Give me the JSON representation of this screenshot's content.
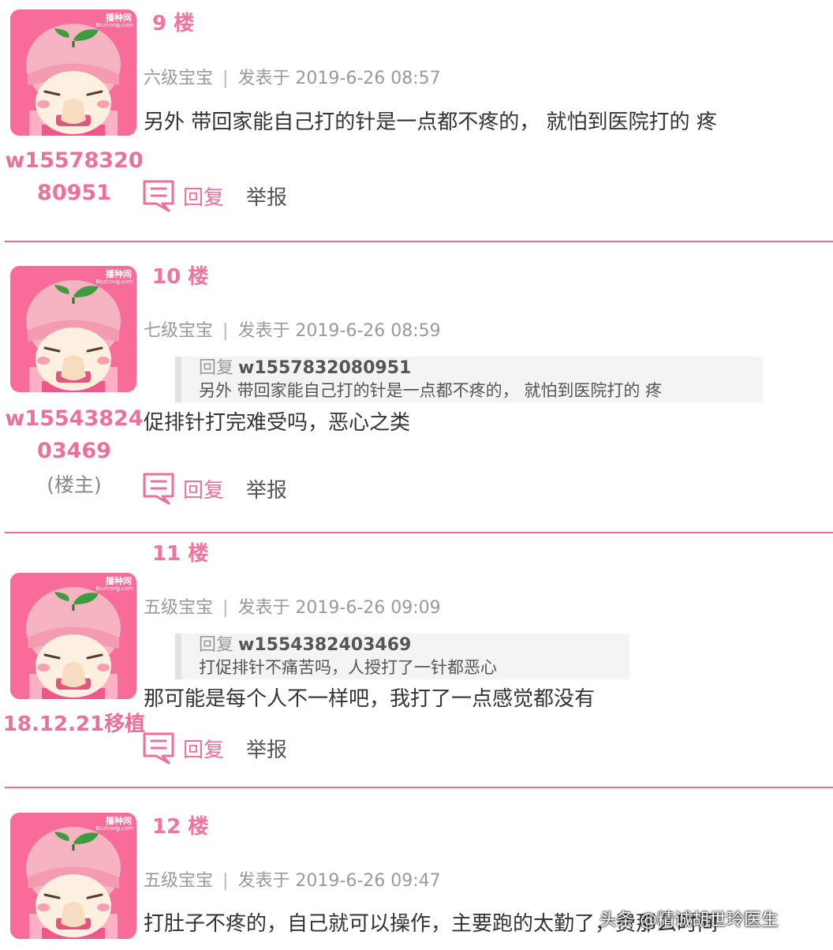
{
  "posts": [
    {
      "floor": "9 楼",
      "level": "六级宝宝",
      "separator": "|",
      "posted": "发表于 2019-6-26 08:57",
      "username": "w1557832080951",
      "owner_tag": "",
      "content": "另外 带回家能自己打的针是一点都不疼的， 就怕到医院打的 疼",
      "actions": {
        "reply": "回复",
        "report": "举报"
      }
    },
    {
      "floor": "10 楼",
      "level": "七级宝宝",
      "separator": "|",
      "posted": "发表于 2019-6-26 08:59",
      "username": "w1554382403469",
      "owner_tag": "(楼主)",
      "quote": {
        "prefix": "回复",
        "user": "w1557832080951",
        "text": "另外 带回家能自己打的针是一点都不疼的， 就怕到医院打的 疼"
      },
      "content": "促排针打完难受吗，恶心之类",
      "actions": {
        "reply": "回复",
        "report": "举报"
      }
    },
    {
      "floor": "11 楼",
      "level": "五级宝宝",
      "separator": "|",
      "posted": "发表于 2019-6-26 09:09",
      "username": "18.12.21移植",
      "owner_tag": "",
      "quote": {
        "prefix": "回复",
        "user": "w1554382403469",
        "text": "打促排针不痛苦吗，人授打了一针都恶心"
      },
      "content": "那可能是每个人不一样吧，我打了一点感觉都没有",
      "actions": {
        "reply": "回复",
        "report": "举报"
      }
    },
    {
      "floor": "12 楼",
      "level": "五级宝宝",
      "separator": "|",
      "posted": "发表于 2019-6-26 09:47",
      "content": "打肚子不疼的，自己就可以操作，主要跑的太勤了，费那么时间"
    }
  ],
  "avatar": {
    "logo_line1": "播种网",
    "logo_line2": "Bozhong.com"
  },
  "watermark": "头条 @精诚胡世玲医生",
  "colors": {
    "accent": "#ee709a",
    "divider": "#ea6b96",
    "avatar_bg": "#f86c99"
  },
  "icons": {
    "reply": "comment-bubble-icon"
  }
}
